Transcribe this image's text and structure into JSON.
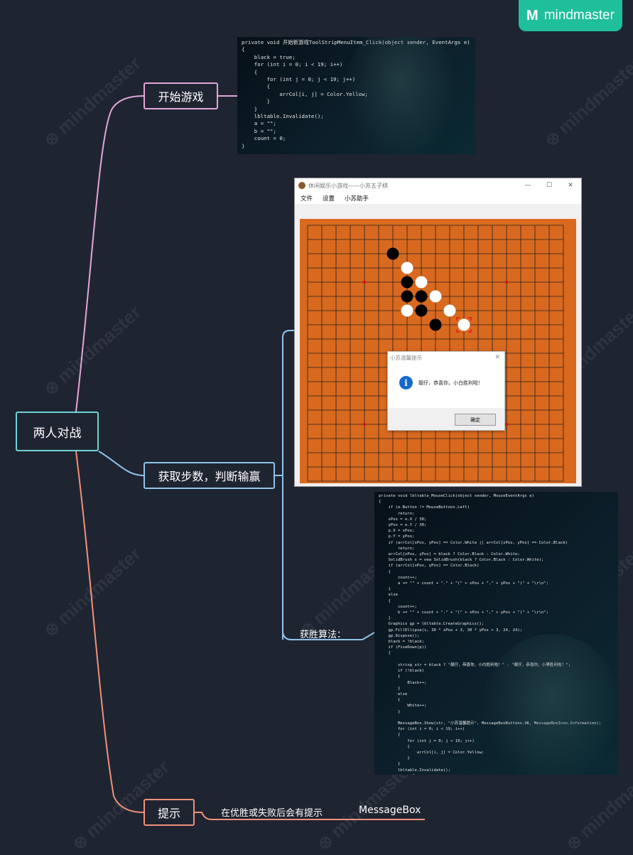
{
  "brand": {
    "logo_mark": "M",
    "logo_text": "mindmaster",
    "watermark_text": "mindmaster",
    "accent_color": "#1fbf9b"
  },
  "mindmap": {
    "root": {
      "label": "两人对战",
      "border_color": "#6ed3d3"
    },
    "branches": [
      {
        "id": "start",
        "label": "开始游戏",
        "color": "#e3a6d8"
      },
      {
        "id": "steps",
        "label": "获取步数，判断输赢",
        "color": "#8fc3ea",
        "children": [
          {
            "label": "获胜算法："
          }
        ]
      },
      {
        "id": "tip",
        "label": "提示",
        "color": "#f0917a",
        "children": [
          {
            "label": "在优胜或失败后会有提示"
          },
          {
            "label": "MessageBox"
          }
        ]
      }
    ]
  },
  "code_start": [
    "private void 开始新游戏ToolStripMenuItem_Click(object sender, EventArgs e)",
    "{",
    "    black = true;",
    "    for (int i = 0; i < 19; i++)",
    "    {",
    "        for (int j = 0; j < 19; j++)",
    "        {",
    "            arrCol[i, j] = Color.Yellow;",
    "        }",
    "    }",
    "    lbltable.Invalidate();",
    "    a = \"\";",
    "    b = \"\";",
    "    count = 0;",
    "}"
  ],
  "code_win": [
    "private void lbltable_MouseClick(object sender, MouseEventArgs e)",
    "{",
    "    if (e.Button != MouseButtons.Left)",
    "        return;",
    "    xPos = e.X / 30;",
    "    yPos = e.Y / 30;",
    "    p.X = xPos;",
    "    p.Y = yPos;",
    "    if (arrCol[xPos, yPos] == Color.White || arrCol[xPos, yPos] == Color.Black)",
    "        return;",
    "    arrCol[xPos, yPos] = black ? Color.Black : Color.White;",
    "    SolidBrush s = new SolidBrush(black ? Color.Black : Color.White);",
    "    if (arrCol[xPos, yPos] == Color.Black)",
    "    {",
    "        count++;",
    "        a += \"\" + count + \".\" + \"(\" + xPos + \",\" + yPos + \")\" + \"\\r\\n\";",
    "    }",
    "    else",
    "    {",
    "        count++;",
    "        b += \"\" + count + \".\" + \"(\" + xPos + \",\" + yPos + \")\" + \"\\r\\n\";",
    "    }",
    "    Graphics gp = lbltable.CreateGraphics();",
    "    gp.FillEllipse(s, 30 * xPos + 3, 30 * yPos + 3, 24, 24);",
    "    gp.Dispose();",
    "    black = !black;",
    "    if (FiveDown(p))",
    "    {",
    "",
    "        string str = black ? \"靓仔，恭喜你，小白胜利啦！\" : \"靓仔，恭喜你，小黑胜利啦！\";",
    "        if (!black)",
    "        {",
    "            Black++;",
    "        }",
    "        else",
    "        {",
    "            White++;",
    "        }",
    "",
    "        MessageBox.Show(str, \"小苏温馨提示\", MessageBoxButtons.OK, MessageBoxIcon.Information);",
    "        for (int i = 0; i < 19; i++)",
    "        {",
    "            for (int j = 0; j < 19; j++)",
    "            {",
    "                arrCol[i, j] = Color.Yellow;",
    "            }",
    "        }",
    "        lbltable.Invalidate();",
    "        max = 4;"
  ],
  "game_window": {
    "title": "休闲娱乐小游戏——小苏五子棋",
    "controls": {
      "minimize": "—",
      "maximize": "☐",
      "close": "✕"
    },
    "menu": [
      "文件",
      "设置",
      "小苏助手"
    ],
    "board_color": "#d9691f",
    "grid_lines": 19,
    "star_points": [
      [
        4,
        4
      ],
      [
        14,
        4
      ],
      [
        4,
        14
      ],
      [
        14,
        14
      ]
    ],
    "black_stones": [
      [
        6,
        2
      ],
      [
        7,
        4
      ],
      [
        7,
        5
      ],
      [
        8,
        5
      ],
      [
        8,
        6
      ],
      [
        9,
        7
      ]
    ],
    "white_stones": [
      [
        7,
        3
      ],
      [
        8,
        4
      ],
      [
        9,
        5
      ],
      [
        7,
        6
      ],
      [
        10,
        6
      ],
      [
        11,
        7
      ]
    ],
    "last_move": [
      11,
      7
    ],
    "dialog": {
      "title": "小苏温馨提示",
      "close": "✕",
      "icon": "i",
      "message": "靓仔，恭喜你，小白胜利啦！",
      "ok_label": "确定"
    }
  }
}
